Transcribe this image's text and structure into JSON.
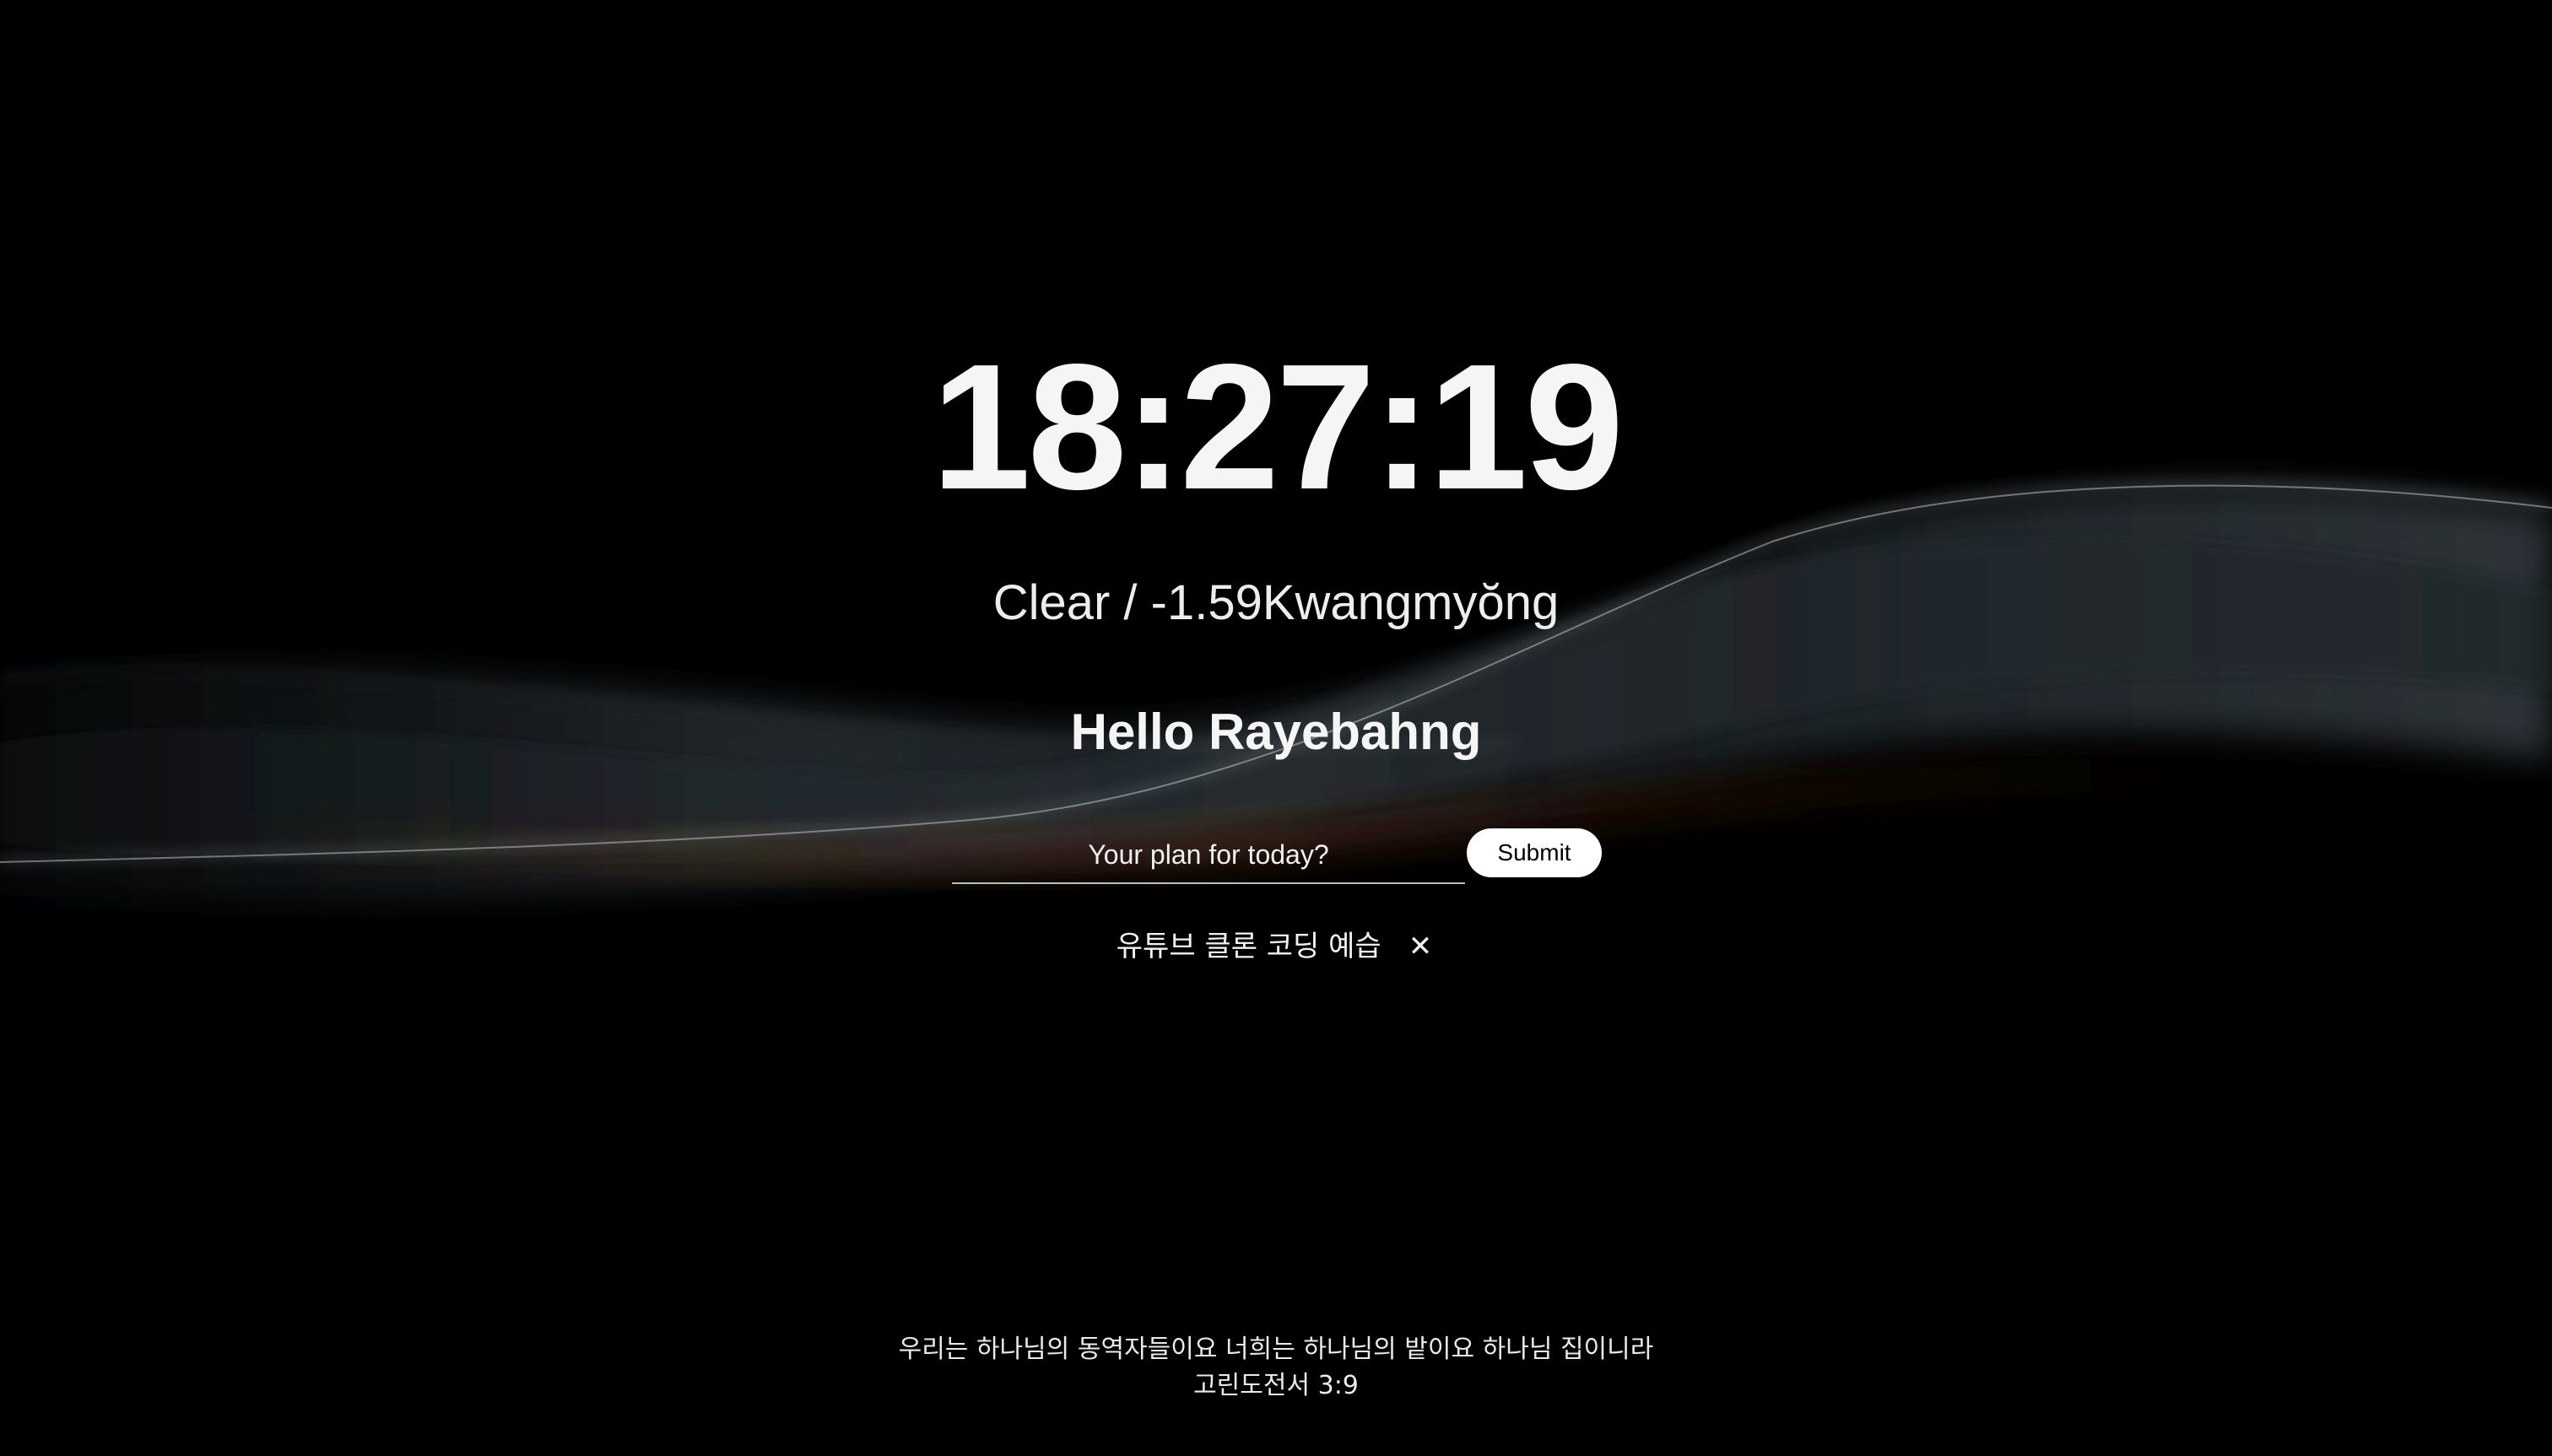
{
  "clock": {
    "time": "18:27:19"
  },
  "weather": {
    "text": "Clear / -1.59Kwangmyŏng"
  },
  "greeting": {
    "text": "Hello Rayebahng"
  },
  "todo_form": {
    "placeholder": "Your plan for today?",
    "submit_label": "Submit"
  },
  "todos": [
    {
      "text": "유튜브 클론 코딩 예습",
      "delete_label": "✕"
    }
  ],
  "quote": {
    "text": "우리는 하나님의 동역자들이요 너희는 하나님의 밭이요 하나님 집이니라",
    "source": "고린도전서 3:9"
  },
  "colors": {
    "background": "#000000",
    "text": "#f2f2f2",
    "button_bg": "#ffffff",
    "button_text": "#000000"
  }
}
